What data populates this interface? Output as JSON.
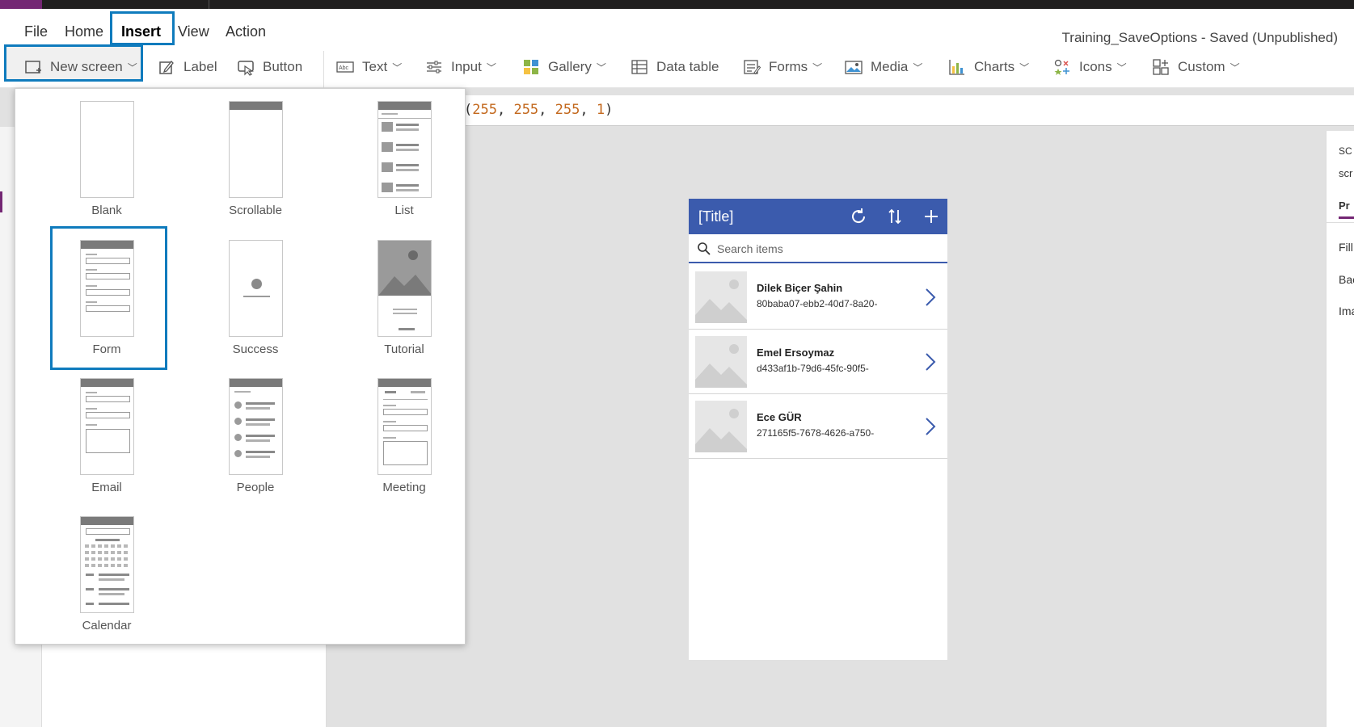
{
  "menu": {
    "items": [
      "File",
      "Home",
      "Insert",
      "View",
      "Action"
    ],
    "active": "Insert"
  },
  "document_title": "Training_SaveOptions - Saved (Unpublished)",
  "ribbon": {
    "new_screen": "New screen",
    "label": "Label",
    "button": "Button",
    "text": "Text",
    "input": "Input",
    "gallery": "Gallery",
    "data_table": "Data table",
    "forms": "Forms",
    "media": "Media",
    "charts": "Charts",
    "icons": "Icons",
    "custom": "Custom"
  },
  "formula": {
    "prefix": "(",
    "v1": "255",
    "v2": "255",
    "v3": "255",
    "v4": "1",
    "suffix": ")",
    "sep": ", "
  },
  "screen_templates": {
    "blank": "Blank",
    "scrollable": "Scrollable",
    "list": "List",
    "form": "Form",
    "success": "Success",
    "tutorial": "Tutorial",
    "email": "Email",
    "people": "People",
    "meeting": "Meeting",
    "calendar": "Calendar",
    "selected": "Form"
  },
  "app": {
    "title": "[Title]",
    "search_placeholder": "Search items",
    "items": [
      {
        "name": "Dilek Biçer Şahin",
        "sub": "80baba07-ebb2-40d7-8a20-"
      },
      {
        "name": "Emel Ersoymaz",
        "sub": "d433af1b-79d6-45fc-90f5-"
      },
      {
        "name": "Ece GÜR",
        "sub": "271165f5-7678-4626-a750-"
      }
    ]
  },
  "right_pane": {
    "t1": "SC",
    "t2": "scr",
    "tab": "Pr",
    "p1": "Fill",
    "p2": "Bac",
    "p3": "Ima"
  },
  "colors": {
    "accent_blue": "#0f7bbd",
    "app_header": "#3b5bad",
    "brand_purple": "#742774"
  }
}
